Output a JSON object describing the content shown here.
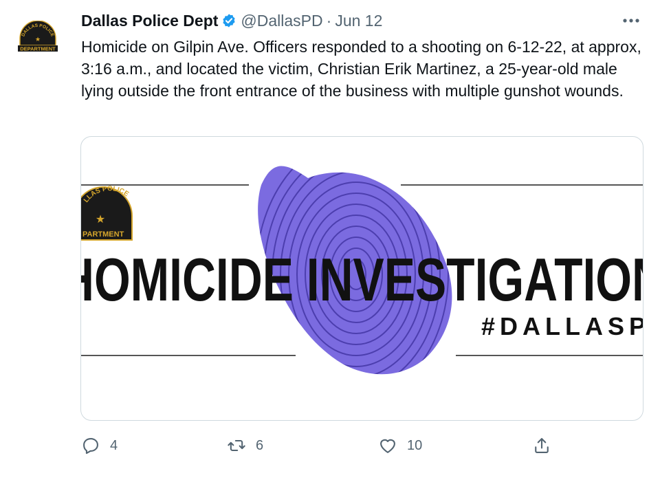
{
  "tweet": {
    "author_name": "Dallas Police Dept",
    "handle": "@DallasPD",
    "separator": "·",
    "date": "Jun 12",
    "text": "Homicide on Gilpin Ave. Officers responded to a shooting on 6-12-22, at approx, 3:16 a.m., and located the victim, Christian Erik Martinez, a 25-year-old male lying outside the front entrance of the business with multiple gunshot wounds."
  },
  "avatar": {
    "badge_top_text": "DALLAS POLICE",
    "badge_bottom_text": "DEPARTMENT"
  },
  "media": {
    "badge_top_text": "LLAS POLICE",
    "badge_bottom_text": "PARTMENT",
    "headline": "HOMICIDE INVESTIGATION",
    "hashtag": "#DALLASPD",
    "fingerprint_color": "#7b6be0"
  },
  "actions": {
    "reply_count": "4",
    "retweet_count": "6",
    "like_count": "10"
  },
  "icons": {
    "verified": "verified-badge-icon",
    "more": "more-options-icon",
    "reply": "reply-icon",
    "retweet": "retweet-icon",
    "like": "heart-icon",
    "share": "share-icon"
  },
  "colors": {
    "verified_blue": "#1d9bf0",
    "secondary_text": "#536471",
    "badge_gold": "#d4a52c"
  }
}
